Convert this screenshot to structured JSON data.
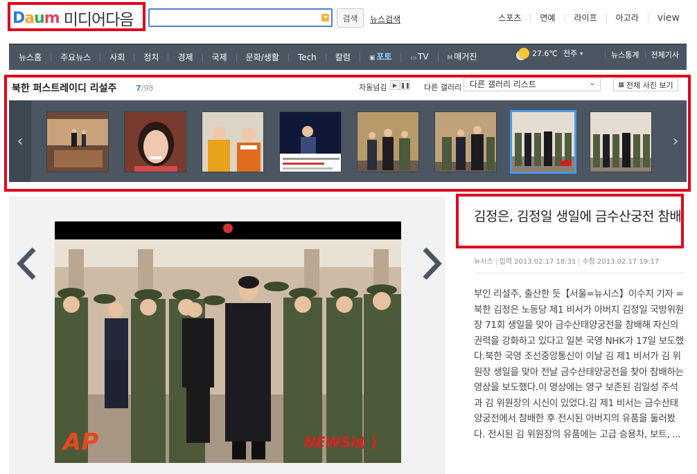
{
  "header": {
    "logo_text": "Daum",
    "logo_colors": [
      "#2e7bd6",
      "#f5a623",
      "#35a853",
      "#e2465d"
    ],
    "section_title": "미디어다음",
    "search_placeholder": "",
    "search_button": "검색",
    "news_search_link": "뉴스검색",
    "top_nav": [
      "스포츠",
      "연예",
      "라이프",
      "아고라",
      "view"
    ]
  },
  "gnb": {
    "items": [
      {
        "label": "뉴스홈"
      },
      {
        "label": "주요뉴스"
      },
      {
        "label": "사회"
      },
      {
        "label": "정치"
      },
      {
        "label": "경제"
      },
      {
        "label": "국제"
      },
      {
        "label": "문화/생활"
      },
      {
        "label": "Tech"
      },
      {
        "label": "칼럼"
      },
      {
        "label": "포토",
        "icon": "photo-icon",
        "active": true
      },
      {
        "label": "TV",
        "icon": "tv-icon"
      },
      {
        "label": "매거진",
        "icon": "magazine-icon"
      }
    ],
    "weather": {
      "temp": "27.6℃",
      "city": "전주",
      "icon": "sun-cloud-icon"
    },
    "right_links": [
      "뉴스통계",
      "전체기사"
    ]
  },
  "gallery": {
    "title": "북한 퍼스트레이디 리설주",
    "current": "7",
    "total": "/98",
    "auto_label": "자동넘김",
    "other_label": "다른 갤러리",
    "other_select_value": "다른 갤러리 리스트",
    "all_photos_button": "전체 사진 보기",
    "prev_label": "‹",
    "next_label": "›",
    "selected_index": 6,
    "thumb_count": 8
  },
  "article": {
    "title": "김정은, 김정일 생일에 금수산궁전 참배",
    "source": "뉴시스",
    "input_date": "입력 2013.02.17 18:31",
    "edit_date": "수정 2013.02.17 19:17",
    "body": "부인 리설주, 출산한 듯【서울=뉴시스】이수지 기자 = 북한 김정은 노동당 제1 비서가 아버지 김정일 국방위원장 71회 생일을 맞아 금수산태양궁전을 참배해 자신의 권력을 강화하고 있다고 일본 국영 NHK가 17일 보도했다.북한 국영 조선중앙통신이 이날 김 제1 비서가 김 위원장 생일을 맞아 전날 금수산태양궁전을 찾아 참배하는 영상을 보도했다.이 영상에는 영구 보존된 김일성 주석과 김 위원장의 시신이 있었다.김 제1 비서는 금수산태양궁전에서 참배한 후 전시된 아버지의 유품을 둘러봤다. 전시된 김 위원장의 유품에는 고급 승용차, 보트, ...",
    "photo_watermark_left": "AP",
    "photo_watermark_right": "NEWSis"
  }
}
